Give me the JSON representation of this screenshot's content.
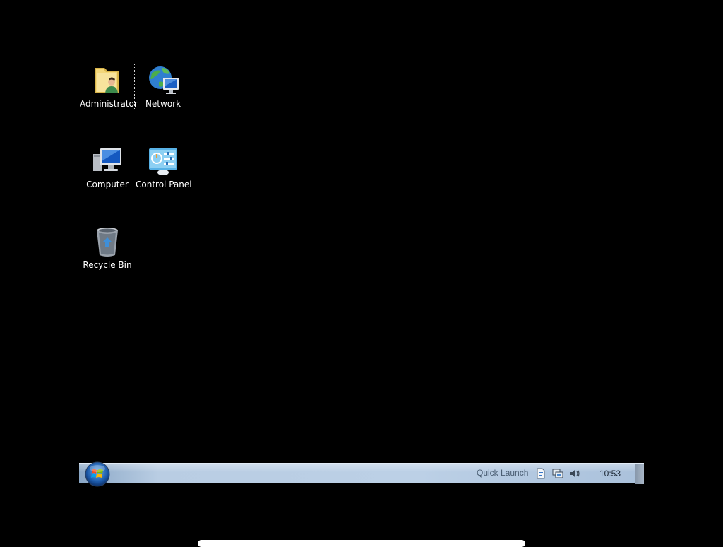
{
  "desktop": {
    "background": "#000000",
    "icons": [
      {
        "label": "Administrator",
        "icon": "user-folder-icon",
        "selected": true
      },
      {
        "label": "Network",
        "icon": "network-icon",
        "selected": false
      },
      {
        "label": "Computer",
        "icon": "computer-icon",
        "selected": false
      },
      {
        "label": "Control Panel",
        "icon": "control-panel-icon",
        "selected": false
      },
      {
        "label": "Recycle Bin",
        "icon": "recycle-bin-icon",
        "selected": false
      }
    ]
  },
  "taskbar": {
    "start_icon": "windows-start-orb-icon",
    "quick_launch_label": "Quick Launch",
    "tray_icons": [
      "document-icon",
      "network-tray-icon",
      "volume-icon"
    ],
    "clock": "10:53"
  }
}
